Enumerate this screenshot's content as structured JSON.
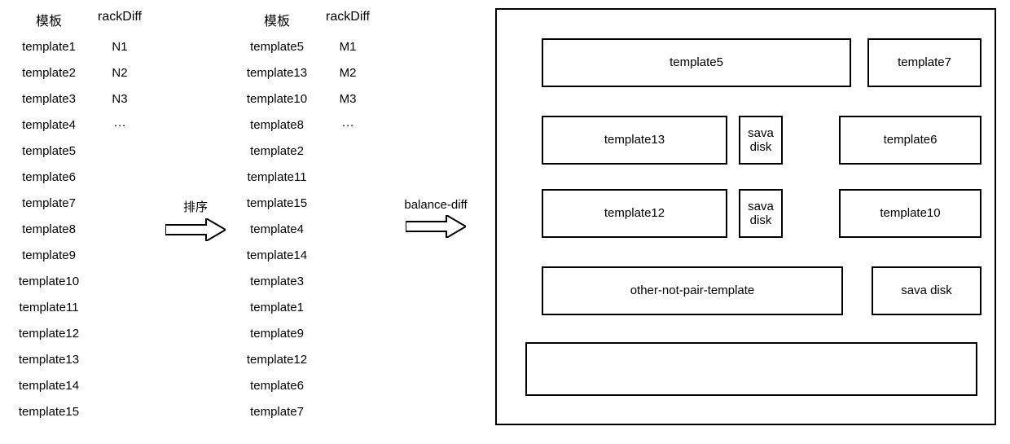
{
  "table1": {
    "head_template": "模板",
    "head_rack": "rackDiff",
    "templates": [
      "template1",
      "template2",
      "template3",
      "template4",
      "template5",
      "template6",
      "template7",
      "template8",
      "template9",
      "template10",
      "template11",
      "template12",
      "template13",
      "template14",
      "template15"
    ],
    "racks": [
      "N1",
      "N2",
      "N3",
      "···"
    ]
  },
  "table2": {
    "head_template": "模板",
    "head_rack": "rackDiff",
    "templates": [
      "template5",
      "template13",
      "template10",
      "template8",
      "template2",
      "template11",
      "template15",
      "template4",
      "template14",
      "template3",
      "template1",
      "template9",
      "template12",
      "template6",
      "template7"
    ],
    "racks": [
      "M1",
      "M2",
      "M3",
      "···"
    ]
  },
  "arrow1_label": "排序",
  "arrow2_label": "balance-diff",
  "box": {
    "t5": "template5",
    "t7": "template7",
    "t13": "template13",
    "sd1": "sava disk",
    "t6": "template6",
    "t12": "template12",
    "sd2": "sava disk",
    "t10": "template10",
    "onp": "other-not-pair-template",
    "sd3": "sava disk",
    "bottom": ""
  }
}
